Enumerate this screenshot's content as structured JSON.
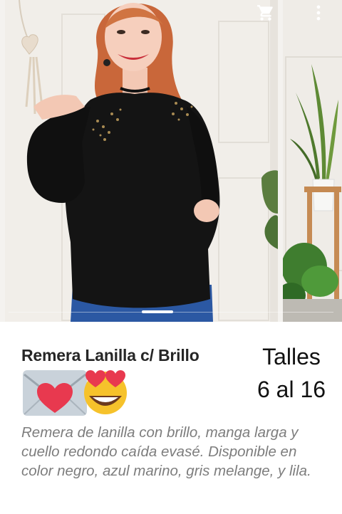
{
  "product": {
    "title": "Remera Lanilla c/ Brillo",
    "sizes_line1": "Talles",
    "sizes_line2": "6 al 16",
    "description": "Remera de lanilla con brillo, manga larga y cuello redondo caída evasé. Disponible en color negro, azul marino, gris melange, y lila."
  },
  "toolbar": {
    "cart_icon": "cart-icon",
    "menu_icon": "more-vert-icon"
  },
  "gallery": {
    "images": 2,
    "active_index": 1
  },
  "emojis": [
    "love-letter-emoji",
    "heart-eyes-emoji"
  ],
  "colors": {
    "title": "#262626",
    "description": "#7d7d7d",
    "sweater": "#141414",
    "hair": "#c9673a",
    "jeans": "#2b58a3"
  }
}
